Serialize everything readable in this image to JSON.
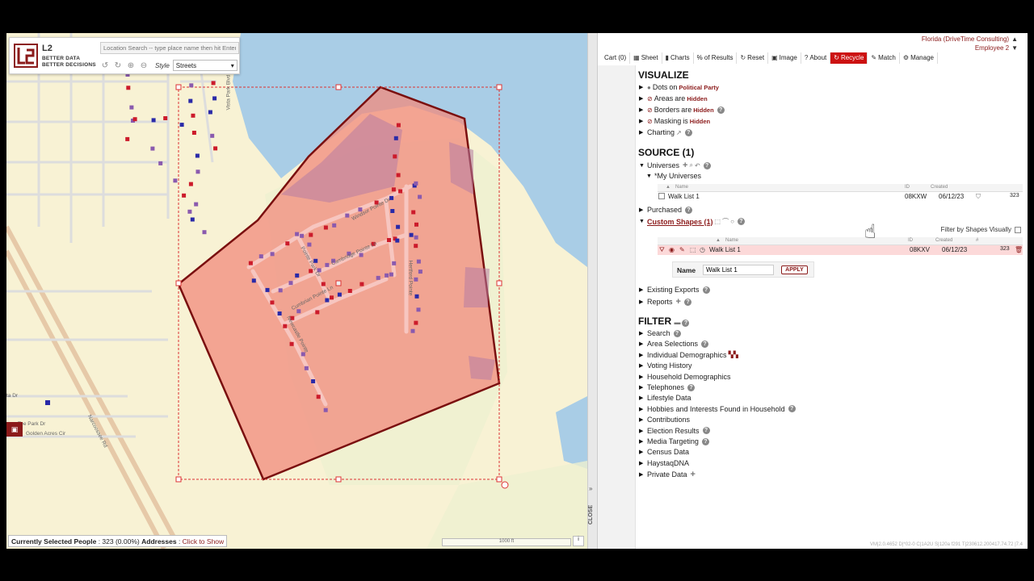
{
  "map": {
    "logo_name": "L2",
    "logo_tag1": "BETTER DATA",
    "logo_tag2": "BETTER DECISIONS",
    "search_placeholder": "Location Search -- type place name then hit Enter",
    "style_label": "Style",
    "style_value": "Streets",
    "street_labels": {
      "vista_park": "Vista Park Blvd",
      "windsor": "Windsor Pointe Dr",
      "cambridge": "Cambridge Pointe Ln",
      "hertford": "Hertford Pointe",
      "cumbrian": "Cumbrian Pointe Ln",
      "new_castle": "Newcastle Pointe",
      "pointe": "Pointe Park Dr",
      "narcoossee": "Narcoossee Rd",
      "ta_dr": "ta Dr",
      "tee_park": "Tee Park Dr",
      "golden_acres": "Golden Acres Cir"
    },
    "status": {
      "label": "Currently Selected People",
      "count": " : 323 (0.00%) ",
      "addresses_label": "Addresses",
      "addresses_sep": " : ",
      "addresses_link": "Click to Show"
    },
    "scale_text": "1000 ft",
    "info_glyph": "i",
    "colors": {
      "land": "#f8f2d4",
      "water": "#a9cde6",
      "shape_fill": "#f28a7c",
      "shape_stroke": "#7a0f0f",
      "dot_red": "#cc1b2b",
      "dot_blue": "#2a2aa8",
      "dot_purple": "#8a5aae"
    }
  },
  "divider": {
    "close_label": "CLOSE",
    "close_arrow": "»"
  },
  "panel": {
    "account": {
      "line1": "Florida (DriveTime Consulting)",
      "line2": "Employee 2"
    },
    "toolbar": [
      {
        "label": "Cart (0)",
        "icon": ""
      },
      {
        "label": "Sheet",
        "icon": "▦"
      },
      {
        "label": "Charts",
        "icon": "▮"
      },
      {
        "label": "% of Results",
        "icon": ""
      },
      {
        "label": "Reset",
        "icon": "↻"
      },
      {
        "label": "Image",
        "icon": "▣"
      },
      {
        "label": "About",
        "icon": "?"
      },
      {
        "label": "Recycle",
        "icon": "↻"
      },
      {
        "label": "Match",
        "icon": "✎"
      },
      {
        "label": "Manage",
        "icon": "⚙"
      }
    ],
    "visualize": {
      "title": "VISUALIZE",
      "dots_label": "Dots",
      "dots_on": "on",
      "dots_value": "Political Party",
      "areas_label": "Areas",
      "areas_are": "are",
      "areas_value": "Hidden",
      "borders_label": "Borders",
      "borders_are": "are",
      "borders_value": "Hidden",
      "masking_label": "Masking",
      "masking_is": "is",
      "masking_value": "Hidden",
      "charting_label": "Charting"
    },
    "source": {
      "title": "SOURCE (1)",
      "universes_label": "Universes",
      "my_universes_label": "*My Universes",
      "universe_table": {
        "headers": {
          "name": "Name",
          "id": "ID",
          "created": "Created"
        },
        "row": {
          "name": "Walk List 1",
          "id": "08KXW",
          "created": "06/12/23",
          "count": "323"
        }
      },
      "purchased_label": "Purchased",
      "custom_shapes_label": "Custom Shapes (1)",
      "filter_by_shapes": "Filter by Shapes Visually",
      "shapes_table": {
        "headers": {
          "name": "Name",
          "id": "ID",
          "created": "Created",
          "count": "#"
        },
        "row": {
          "name": "Walk List 1",
          "id": "08KXV",
          "created": "06/12/23",
          "count": "323"
        }
      },
      "name_form": {
        "label": "Name",
        "value": "Walk List 1",
        "apply": "APPLY"
      },
      "existing_exports_label": "Existing Exports",
      "reports_label": "Reports"
    },
    "filter": {
      "title": "FILTER",
      "items": [
        "Search",
        "Area Selections",
        "Individual Demographics",
        "Voting History",
        "Household Demographics",
        "Telephones",
        "Lifestyle Data",
        "Hobbies and Interests Found in Household",
        "Contributions",
        "Election Results",
        "Media Targeting",
        "Census Data",
        "HaystaqDNA",
        "Private Data"
      ]
    },
    "version": "VM|2.0.4652 D|*02-0 C|1A2U S|120a f291 T|230612.200417.74.72 |7.4"
  }
}
